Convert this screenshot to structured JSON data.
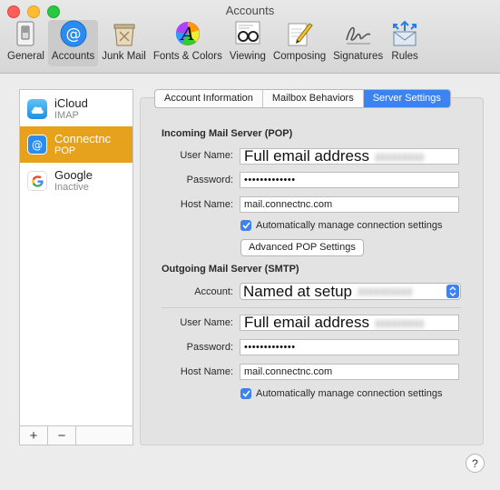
{
  "window": {
    "title": "Accounts"
  },
  "toolbar": {
    "items": [
      {
        "label": "General",
        "icon": "general-switch-icon"
      },
      {
        "label": "Accounts",
        "icon": "at-sign-icon",
        "active": true
      },
      {
        "label": "Junk Mail",
        "icon": "trash-bin-icon"
      },
      {
        "label": "Fonts & Colors",
        "icon": "color-wheel-icon"
      },
      {
        "label": "Viewing",
        "icon": "glasses-icon"
      },
      {
        "label": "Composing",
        "icon": "pencil-icon"
      },
      {
        "label": "Signatures",
        "icon": "signature-icon"
      },
      {
        "label": "Rules",
        "icon": "envelope-arrows-icon"
      }
    ]
  },
  "sidebar": {
    "accounts": [
      {
        "name": "iCloud",
        "type": "IMAP",
        "icon": "cloud-icon",
        "selected": false
      },
      {
        "name": "Connectnc",
        "type": "POP",
        "icon": "at-sign-icon",
        "selected": true
      },
      {
        "name": "Google",
        "type": "Inactive",
        "icon": "google-g-icon",
        "selected": false
      }
    ],
    "add_label": "+",
    "remove_label": "−"
  },
  "tabs": [
    {
      "label": "Account Information",
      "active": false
    },
    {
      "label": "Mailbox Behaviors",
      "active": false
    },
    {
      "label": "Server Settings",
      "active": true
    }
  ],
  "incoming": {
    "title": "Incoming Mail Server (POP)",
    "user_label": "User Name:",
    "user_value": "Full email address",
    "password_label": "Password:",
    "password_value": "•••••••••••••",
    "host_label": "Host Name:",
    "host_value": "mail.connectnc.com",
    "auto_manage_label": "Automatically manage connection settings",
    "auto_manage_checked": true,
    "advanced_button": "Advanced POP Settings"
  },
  "outgoing": {
    "title": "Outgoing Mail Server (SMTP)",
    "account_label": "Account:",
    "account_value": "Named at setup",
    "user_label": "User Name:",
    "user_value": "Full email address",
    "password_label": "Password:",
    "password_value": "•••••••••••••",
    "host_label": "Host Name:",
    "host_value": "mail.connectnc.com",
    "auto_manage_label": "Automatically manage connection settings",
    "auto_manage_checked": true
  },
  "help_label": "?",
  "colors": {
    "accent": "#3b82f2",
    "selection": "#e6a11d"
  }
}
